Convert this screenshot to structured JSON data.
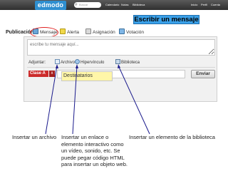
{
  "topbar": {
    "logo": "edmodo",
    "search_placeholder": "Buscar",
    "nav": [
      "Calendario",
      "Notas",
      "Biblioteca"
    ],
    "right_nav": [
      "Inicio",
      "Perfil",
      "Cuenta"
    ]
  },
  "banner": "Escribir un mensaje",
  "publication": {
    "label": "Publicación:",
    "tabs": [
      "Mensaje",
      "Alerta",
      "Asignación",
      "Votación"
    ]
  },
  "compose": {
    "placeholder": "escribe tu mensaje aquí...",
    "attach_label": "Adjuntar:",
    "attach_items": [
      "Archivo",
      "Hipervínculo",
      "Biblioteca"
    ],
    "class_chip": "Clase A",
    "chip_remove": "x",
    "recipients_label": "Destinatarios",
    "send_label": "Enviar"
  },
  "notes": {
    "file": "Insertar un archivo",
    "link": "Insertar un enlace o elemento interactivo como un vídeo, sonido, etc. Se puede pegar código HTML para insertar un objeto web.",
    "library": "Insertar un elemento de la biblioteca"
  },
  "colors": {
    "banner": "#3aa0e8",
    "chip": "#cc2b2b",
    "highlight_ring": "#e02020",
    "recipients_bg": "#fff6a8"
  }
}
